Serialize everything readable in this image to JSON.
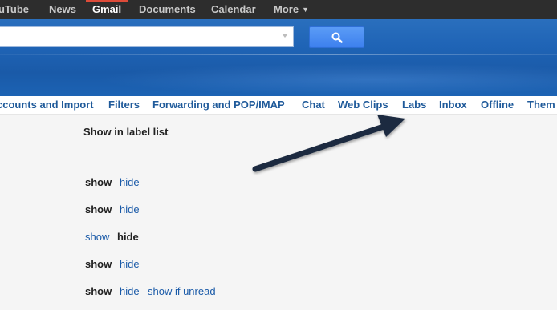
{
  "topbar": {
    "items": [
      "uTube",
      "News",
      "Gmail",
      "Documents",
      "Calendar",
      "More"
    ],
    "active": "Gmail"
  },
  "search": {
    "value": "",
    "placeholder": "",
    "button_icon": "search-icon"
  },
  "tabs": [
    "ccounts and Import",
    "Filters",
    "Forwarding and POP/IMAP",
    "Chat",
    "Web Clips",
    "Labs",
    "Inbox",
    "Offline",
    "Them"
  ],
  "content": {
    "heading": "Show in label list",
    "rows": [
      {
        "show": "show",
        "hide": "hide",
        "selected": "show"
      },
      {
        "show": "show",
        "hide": "hide",
        "selected": "show"
      },
      {
        "show": "show",
        "hide": "hide",
        "selected": "hide"
      },
      {
        "show": "show",
        "hide": "hide",
        "selected": "show"
      },
      {
        "show": "show",
        "hide": "hide",
        "extra": "show if unread",
        "selected": "show"
      }
    ]
  },
  "annotation": {
    "arrow_points_to": "Labs"
  },
  "colors": {
    "topbar": "#2d2d2d",
    "header_blue": "#1f64b6",
    "tab_link": "#1f5a9a",
    "link": "#1a5aa8",
    "search_button": "#4d90fe",
    "arrow": "#1b2a41"
  }
}
